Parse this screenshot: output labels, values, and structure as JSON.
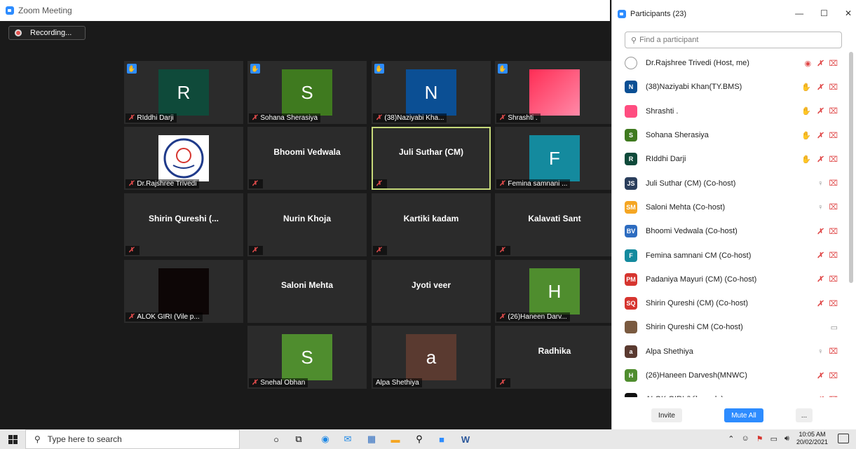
{
  "window": {
    "title": "Zoom Meeting",
    "recording_label": "Recording..."
  },
  "tiles": [
    {
      "name": "RIddhi Darji",
      "initial": "R",
      "color": "#0f4a3a",
      "hand": true
    },
    {
      "name": "Sohana Sherasiya",
      "initial": "S",
      "color": "#3f7a1f",
      "hand": true
    },
    {
      "name": "(38)Naziyabi Kha...",
      "initial": "N",
      "color": "#0b4f94",
      "hand": true
    },
    {
      "name": "Shrashti .",
      "initial": "",
      "color": "#ff4d80",
      "hand": true
    },
    {
      "name": "Dr.Rajshree Trivedi",
      "logo": true
    },
    {
      "name": "",
      "center": "Bhoomi Vedwala"
    },
    {
      "name": "",
      "center": "Juli Suthar (CM)",
      "active": true
    },
    {
      "name": "Femina samnani ...",
      "initial": "F",
      "color": "#148a9e"
    },
    {
      "name": "",
      "center": "Shirin Qureshi (..."
    },
    {
      "name": "",
      "center": "Nurin Khoja"
    },
    {
      "name": "",
      "center": "Kartiki kadam"
    },
    {
      "name": "",
      "center": "Kalavati Sant"
    },
    {
      "name": "ALOK GIRI (Vile p...",
      "dark": true
    },
    {
      "name": "",
      "center": "Saloni Mehta",
      "nomute": true
    },
    {
      "name": "",
      "center": "Jyoti veer",
      "nomute": true
    },
    {
      "name": "(26)Haneen Darv...",
      "initial": "H",
      "color": "#4f8d2e"
    },
    {
      "name": "Snehal Obhan",
      "initial": "S",
      "color": "#4f8d2e"
    },
    {
      "name": "Alpa Shethiya",
      "initial": "a",
      "color": "#5a3a30",
      "nomute": true
    },
    {
      "name": "",
      "center": "Radhika"
    }
  ],
  "panel": {
    "title": "Participants (23)",
    "search_placeholder": "Find a participant",
    "invite_label": "Invite",
    "mute_all_label": "Mute All",
    "more_label": "...",
    "participants": [
      {
        "name": "Dr.Rajshree Trivedi (Host, me)",
        "av": "",
        "color": "#ffffff",
        "icons": [
          "rec",
          "mic-off",
          "vid-off"
        ]
      },
      {
        "name": "(38)Naziyabi Khan(TY.BMS)",
        "av": "N",
        "color": "#0b4f94",
        "icons": [
          "hand",
          "mic-off",
          "vid-off"
        ]
      },
      {
        "name": "Shrashti .",
        "av": "",
        "color": "#ff4d80",
        "icons": [
          "hand",
          "mic-off",
          "vid-off"
        ]
      },
      {
        "name": "Sohana Sherasiya",
        "av": "S",
        "color": "#3f7a1f",
        "icons": [
          "hand",
          "mic-off",
          "vid-off"
        ]
      },
      {
        "name": "RIddhi Darji",
        "av": "R",
        "color": "#0f4a3a",
        "icons": [
          "hand",
          "mic-off",
          "vid-off"
        ]
      },
      {
        "name": "Juli Suthar (CM) (Co-host)",
        "av": "JS",
        "color": "#2a3e5c",
        "icons": [
          "mic",
          "vid-off"
        ]
      },
      {
        "name": "Saloni Mehta (Co-host)",
        "av": "SM",
        "color": "#f5a623",
        "icons": [
          "mic",
          "vid-off"
        ]
      },
      {
        "name": "Bhoomi Vedwala (Co-host)",
        "av": "BV",
        "color": "#2d6cc0",
        "icons": [
          "mic-off",
          "vid-off"
        ]
      },
      {
        "name": "Femina samnani CM (Co-host)",
        "av": "F",
        "color": "#148a9e",
        "icons": [
          "mic-off",
          "vid-off"
        ]
      },
      {
        "name": "Padaniya Mayuri (CM) (Co-host)",
        "av": "PM",
        "color": "#d6352f",
        "icons": [
          "mic-off",
          "vid-off"
        ]
      },
      {
        "name": "Shirin Qureshi (CM) (Co-host)",
        "av": "SQ",
        "color": "#d6352f",
        "icons": [
          "mic-off",
          "vid-off"
        ]
      },
      {
        "name": "Shirin Qureshi CM (Co-host)",
        "av": "",
        "color": "#7a5a40",
        "icons": [
          "vid"
        ]
      },
      {
        "name": "Alpa Shethiya",
        "av": "a",
        "color": "#5a3a30",
        "icons": [
          "mic",
          "vid-off"
        ]
      },
      {
        "name": "(26)Haneen Darvesh(MNWC)",
        "av": "H",
        "color": "#4f8d2e",
        "icons": [
          "mic-off",
          "vid-off"
        ]
      },
      {
        "name": "ALOK GIRI (Vile parle)",
        "av": "",
        "color": "#111111",
        "icons": [
          "mic-off",
          "vid-off"
        ]
      }
    ]
  },
  "taskbar": {
    "search_placeholder": "Type here to search",
    "time": "10:05 AM",
    "date": "20/02/2021"
  }
}
